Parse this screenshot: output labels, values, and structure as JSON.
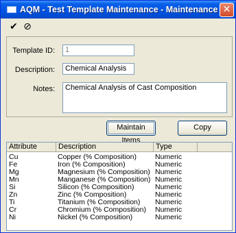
{
  "window": {
    "title": "AQM - Test Template Maintenance - Maintenance",
    "close_symbol": "✕"
  },
  "toolbar": {
    "save_icon": "check-icon",
    "save_symbol": "✔",
    "cancel_icon": "cancel-icon",
    "cancel_symbol": "⊘"
  },
  "form": {
    "template_id_label": "Template ID:",
    "template_id_value": "1",
    "description_label": "Description:",
    "description_value": "Chemical Analysis",
    "notes_label": "Notes:",
    "notes_value": "Chemical Analysis of Cast Composition"
  },
  "buttons": {
    "maintain_items": "Maintain Items",
    "copy": "Copy"
  },
  "grid": {
    "columns": [
      "Attribute",
      "Description",
      "Type"
    ],
    "rows": [
      [
        "Cu",
        "Copper (% Composition)",
        "Numeric"
      ],
      [
        "Fe",
        "Iron (% Composition)",
        "Numeric"
      ],
      [
        "Mg",
        "Magnesium (% Composition)",
        "Numeric"
      ],
      [
        "Mn",
        "Manganese (% Composition)",
        "Numeric"
      ],
      [
        "Si",
        "Silicon (% Composition)",
        "Numeric"
      ],
      [
        "Zn",
        "Zinc (% Composition)",
        "Numeric"
      ],
      [
        "Ti",
        "Titanium (% Composition)",
        "Numeric"
      ],
      [
        "Cr",
        "Chromium (% Composition)",
        "Numeric"
      ],
      [
        "Ni",
        "Nickel (% Composition)",
        "Numeric"
      ]
    ]
  },
  "colors": {
    "titlebar": "#0054e3",
    "window_bg": "#ece9d8",
    "close_button": "#d14b2c"
  }
}
